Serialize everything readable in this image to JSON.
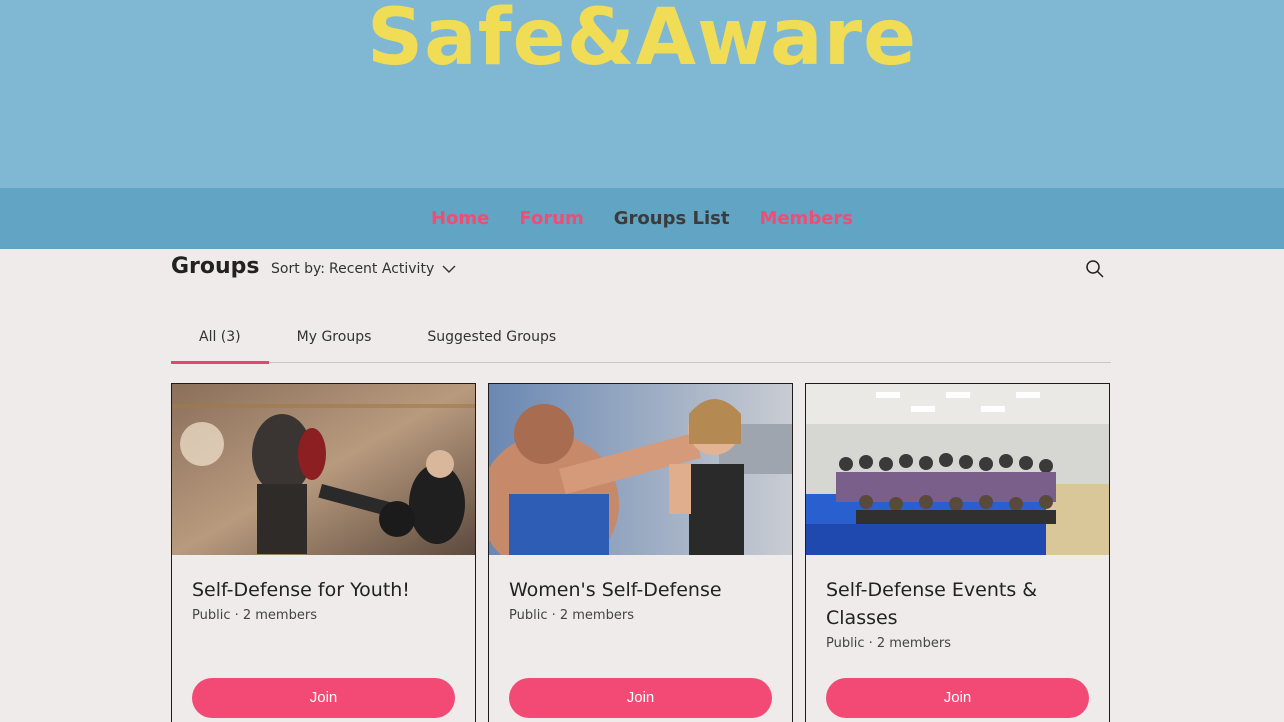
{
  "site": {
    "title": "Safe&Aware"
  },
  "nav": {
    "items": [
      {
        "label": "Home",
        "active": false
      },
      {
        "label": "Forum",
        "active": false
      },
      {
        "label": "Groups List",
        "active": true
      },
      {
        "label": "Members",
        "active": false
      }
    ]
  },
  "groups_header": {
    "title": "Groups",
    "sort_label": "Sort by:",
    "sort_value": "Recent Activity",
    "search_icon": "search-icon"
  },
  "tabs": [
    {
      "label": "All (3)",
      "active": true
    },
    {
      "label": "My Groups",
      "active": false
    },
    {
      "label": "Suggested Groups",
      "active": false
    }
  ],
  "cards": [
    {
      "title": "Self-Defense for Youth!",
      "meta": "Public · 2 members",
      "button": "Join"
    },
    {
      "title": "Women's Self-Defense",
      "meta": "Public · 2 members",
      "button": "Join"
    },
    {
      "title": "Self-Defense Events & Classes",
      "meta": "Public · 2 members",
      "button": "Join"
    }
  ],
  "colors": {
    "hero_bg": "#80b8d4",
    "nav_bg": "#62a4c4",
    "title_yellow": "#f0dc55",
    "accent_pink": "#f24a74"
  }
}
